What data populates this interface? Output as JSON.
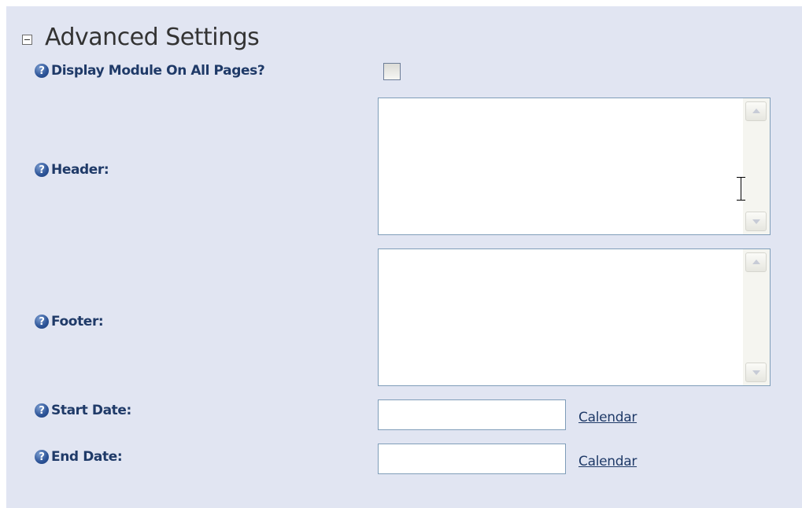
{
  "section": {
    "title": "Advanced Settings",
    "toggle_icon": "collapse-minus-icon"
  },
  "fields": {
    "display_all_pages": {
      "label": "Display Module On All Pages?",
      "checked": false
    },
    "header": {
      "label": "Header:",
      "value": ""
    },
    "footer": {
      "label": "Footer:",
      "value": ""
    },
    "start_date": {
      "label": "Start Date:",
      "value": "",
      "calendar_label": "Calendar"
    },
    "end_date": {
      "label": "End Date:",
      "value": "",
      "calendar_label": "Calendar"
    }
  },
  "help_icon_glyph": "?",
  "colors": {
    "panel_bg": "#e1e5f2",
    "label_text": "#1f3a68",
    "input_border": "#7f9db9"
  }
}
